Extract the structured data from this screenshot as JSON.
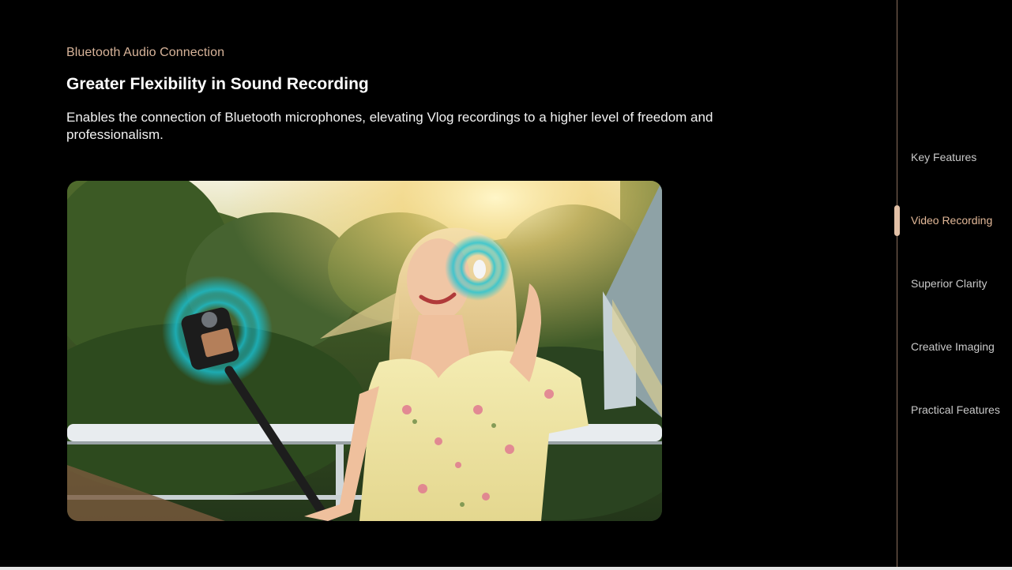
{
  "section": {
    "eyebrow": "Bluetooth Audio Connection",
    "headline": "Greater Flexibility in Sound Recording",
    "description": "Enables the connection of Bluetooth microphones, elevating Vlog recordings to a higher level of freedom and professionalism."
  },
  "side_nav": {
    "items": [
      {
        "label": "Key Features",
        "active": false
      },
      {
        "label": "Video Recording",
        "active": true
      },
      {
        "label": "Superior Clarity",
        "active": false
      },
      {
        "label": "Creative Imaging",
        "active": false
      },
      {
        "label": "Practical Features",
        "active": false
      }
    ]
  },
  "colors": {
    "accent": "#e2b898",
    "background": "#000000",
    "text": "#ffffff"
  }
}
